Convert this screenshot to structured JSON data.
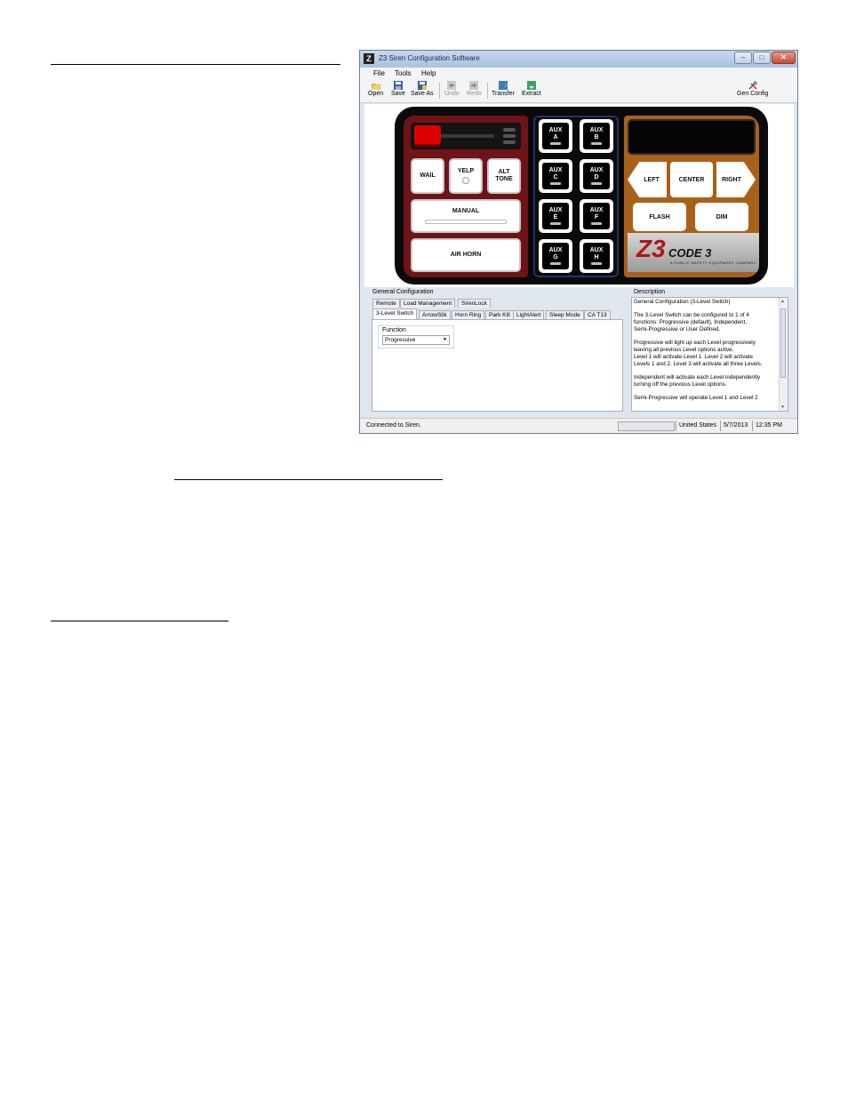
{
  "window": {
    "title": "Z3 Siren Configuration Software",
    "app_icon_letter": "Z",
    "controls": {
      "minimize": "–",
      "maximize": "□",
      "close": "✕"
    }
  },
  "menu": [
    "File",
    "Tools",
    "Help"
  ],
  "toolbar": {
    "items": [
      {
        "label": "Open",
        "icon": "open-folder-icon",
        "enabled": true
      },
      {
        "label": "Save",
        "icon": "save-disk-icon",
        "enabled": true
      },
      {
        "label": "Save As",
        "icon": "save-as-icon",
        "enabled": true
      },
      {
        "label": "Undo",
        "icon": "undo-icon",
        "enabled": false
      },
      {
        "label": "Redo",
        "icon": "redo-icon",
        "enabled": false
      },
      {
        "label": "Transfer",
        "icon": "transfer-icon",
        "enabled": true
      },
      {
        "label": "Extract",
        "icon": "extract-icon",
        "enabled": true
      }
    ],
    "gen_config": "Gen Config"
  },
  "controller": {
    "buttons": {
      "wail": "WAIL",
      "yelp": "YELP",
      "alt_tone": "ALT\nTONE",
      "manual": "MANUAL",
      "air_horn": "AIR HORN"
    },
    "aux": [
      "AUX\nA",
      "AUX\nB",
      "AUX\nC",
      "AUX\nD",
      "AUX\nE",
      "AUX\nF",
      "AUX\nG",
      "AUX\nH"
    ],
    "arrows": {
      "left": "LEFT",
      "center": "CENTER",
      "right": "RIGHT"
    },
    "flash": "FLASH",
    "dim": "DIM",
    "logo": {
      "mark": "Z3",
      "brand": "CODE 3",
      "tagline": "A PUBLIC SAFETY EQUIPMENT COMPANY"
    }
  },
  "general": {
    "label": "General Configuration",
    "tabs_row1": [
      "Remote",
      "Load Management",
      "SirenLock"
    ],
    "tabs_row2": [
      "3-Level Switch",
      "ArrowStik",
      "Horn Ring",
      "Park Kill",
      "LightAlert",
      "Sleep Mode",
      "CA T13"
    ],
    "selected_tab": "3-Level Switch",
    "function_label": "Function",
    "function_value": "Progressive"
  },
  "description": {
    "label": "Description",
    "paragraphs": [
      "General Configuration (3-Level Switch)",
      "The 3-Level Switch can be configured to 1 of 4\nfunctions: Progressive (default), Independent,\nSemi-Progressive or User Defined.",
      "Progressive will light up each Level progressively\nleaving all previous Level options active.\nLevel 1 will activate Level 1.  Level 2 will activate\nLevels 1 and 2.  Level 3 will activate all three Levels.",
      "Independent will activate each Level independently\nturning off the previous Level options.",
      "Semi-Progressive will operate Level 1 and Level 2"
    ]
  },
  "status": {
    "message": "Connected to Siren.",
    "region": "United States",
    "date": "5/7/2013",
    "time": "12:35 PM"
  }
}
